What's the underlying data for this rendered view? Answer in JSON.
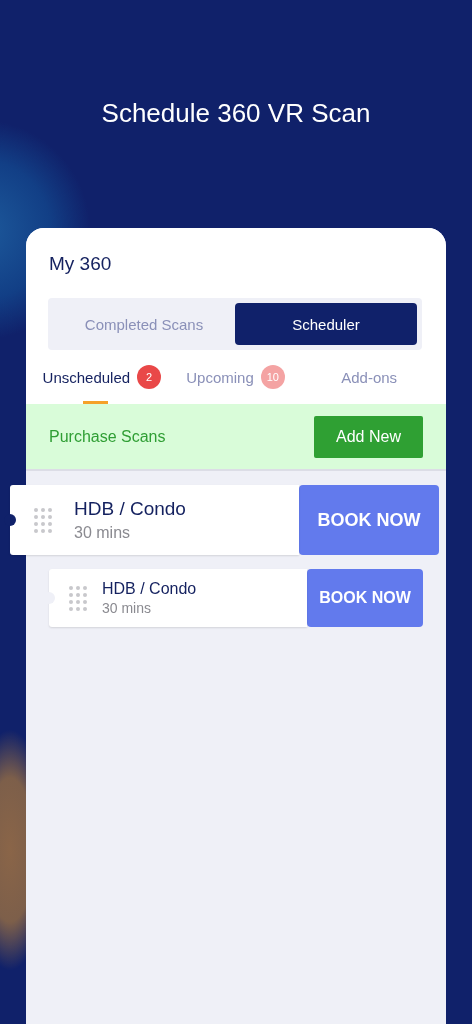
{
  "screen_title": "Schedule 360 VR Scan",
  "card": {
    "title": "My 360",
    "segments": [
      {
        "label": "Completed Scans",
        "selected": false
      },
      {
        "label": "Scheduler",
        "selected": true
      }
    ],
    "tabs": [
      {
        "label": "Unscheduled",
        "badge": "2",
        "selected": true
      },
      {
        "label": "Upcoming",
        "badge": "10",
        "selected": false
      },
      {
        "label": "Add-ons",
        "selected": false
      }
    ],
    "purchase_bar": {
      "label": "Purchase Scans",
      "button": "Add New"
    },
    "scans": [
      {
        "name": "HDB / Condo",
        "duration": "30 mins",
        "button": "BOOK NOW",
        "lifted": true
      },
      {
        "name": "HDB / Condo",
        "duration": "30 mins",
        "button": "BOOK NOW",
        "lifted": false
      }
    ]
  }
}
